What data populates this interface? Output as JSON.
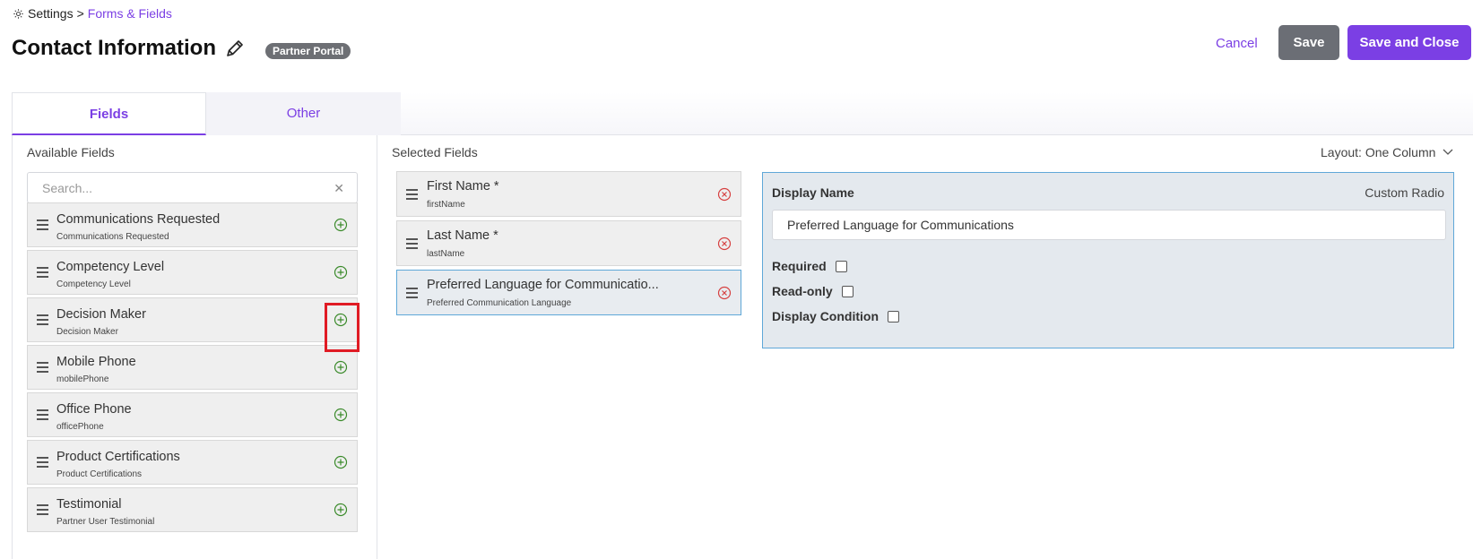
{
  "breadcrumb": {
    "root": "Settings",
    "separator": ">",
    "current": "Forms & Fields"
  },
  "page": {
    "title": "Contact Information",
    "badge": "Partner Portal"
  },
  "actions": {
    "cancel": "Cancel",
    "save": "Save",
    "save_close": "Save and Close"
  },
  "tabs": [
    {
      "label": "Fields",
      "active": true
    },
    {
      "label": "Other",
      "active": false
    }
  ],
  "available": {
    "title": "Available Fields",
    "search_placeholder": "Search...",
    "clear": "✕",
    "items": [
      {
        "name": "Communications Requested",
        "api": "Communications Requested"
      },
      {
        "name": "Competency Level",
        "api": "Competency Level"
      },
      {
        "name": "Decision Maker",
        "api": "Decision Maker"
      },
      {
        "name": "Mobile Phone",
        "api": "mobilePhone"
      },
      {
        "name": "Office Phone",
        "api": "officePhone"
      },
      {
        "name": "Product Certifications",
        "api": "Product Certifications"
      },
      {
        "name": "Testimonial",
        "api": "Partner User Testimonial"
      }
    ]
  },
  "selected": {
    "title": "Selected Fields",
    "layout": "Layout: One Column",
    "items": [
      {
        "name": "First Name *",
        "api": "firstName"
      },
      {
        "name": "Last Name *",
        "api": "lastName"
      },
      {
        "name": "Preferred Language for Communicatio...",
        "api": "Preferred Communication Language",
        "active": true
      }
    ]
  },
  "detail": {
    "display_name_label": "Display Name",
    "type": "Custom Radio",
    "display_name_value": "Preferred Language for Communications",
    "required_label": "Required",
    "readonly_label": "Read-only",
    "condition_label": "Display Condition",
    "required": false,
    "readonly": false,
    "condition": false
  },
  "colors": {
    "accent": "#7b3fe4",
    "add": "#3a8a2a",
    "remove": "#d64040",
    "highlight": "#e01b24"
  }
}
